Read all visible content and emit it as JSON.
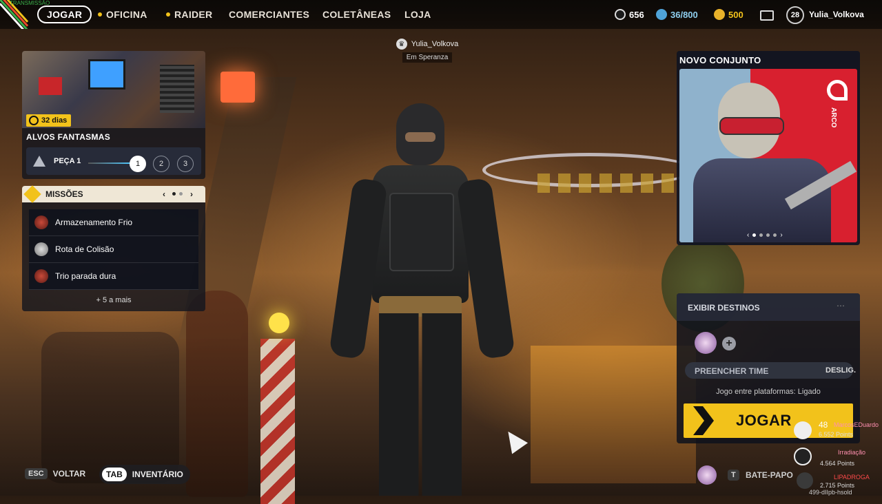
{
  "header": {
    "top_left_text": "TRANSMISSÃO",
    "nav": [
      "JOGAR",
      "OFICINA",
      "RAIDER",
      "COMERCIANTES",
      "COLETÂNEAS",
      "LOJA"
    ],
    "currency": {
      "coins": "656",
      "credits": "36/800",
      "tokens": "500"
    },
    "player": {
      "level": "28",
      "name": "Yulia_Volkova"
    }
  },
  "event": {
    "timer": "32 dias",
    "title": "ALVOS FANTASMAS",
    "piece_label": "PEÇA 1",
    "steps": [
      "1",
      "2",
      "3"
    ],
    "active_step": 1
  },
  "missions": {
    "title": "MISSÕES",
    "items": [
      "Armazenamento Frio",
      "Rota de Colisão",
      "Trio parada dura"
    ],
    "more": "+ 5 a mais"
  },
  "character": {
    "name": "Yulia_Volkova",
    "location": "Em Speranza"
  },
  "promo": {
    "title": "NOVO CONJUNTO",
    "brand": "ARCO"
  },
  "lobby": {
    "destinations_label": "EXIBIR DESTINOS",
    "menu_icon": "more-dots-icon",
    "fill_team_label": "PREENCHER TIME",
    "fill_team_value": "DESLIG.",
    "crossplay": "Jogo entre plataformas: Ligado",
    "play_label": "JOGAR",
    "chat_key": "T",
    "chat_label": "BATE-PAPO"
  },
  "footer": {
    "back_key": "ESC",
    "back_label": "VOLTAR",
    "inventory_key": "TAB",
    "inventory_label": "INVENTÁRIO"
  },
  "stream_overlay": {
    "entries": [
      {
        "rank": "48",
        "name": "MarcosEDuardo",
        "points": "6.552 Points"
      },
      {
        "rank": "",
        "name": "Irradiação",
        "points": "4.564 Points"
      },
      {
        "rank": "",
        "name": "LIPADROGA",
        "points": "2.715 Points"
      }
    ],
    "code": "499-dIIpb-hsold"
  },
  "colors": {
    "accent_yellow": "#f2c21b",
    "panel_dark": "#14161e",
    "promo_red": "#d8202f",
    "promo_blue": "#8fb2cc"
  }
}
